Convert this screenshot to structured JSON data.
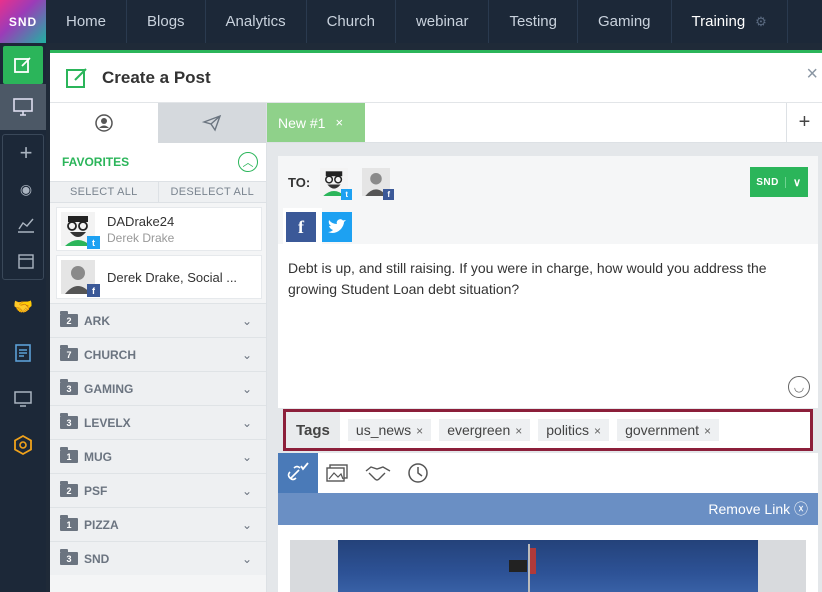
{
  "logo": "SND",
  "nav_tabs": [
    "Home",
    "Blogs",
    "Analytics",
    "Church",
    "webinar",
    "Testing",
    "Gaming",
    "Training"
  ],
  "modal": {
    "title": "Create a Post",
    "close": "×"
  },
  "left": {
    "favorites_label": "FAVORITES",
    "select_all": "SELECT ALL",
    "deselect_all": "DESELECT ALL",
    "accounts": [
      {
        "name": "DADrake24",
        "sub": "Derek Drake",
        "network": "twitter"
      },
      {
        "name": "Derek Drake, Social ...",
        "sub": "",
        "network": "facebook"
      }
    ],
    "groups": [
      {
        "count": "2",
        "name": "ARK"
      },
      {
        "count": "7",
        "name": "CHURCH"
      },
      {
        "count": "3",
        "name": "GAMING"
      },
      {
        "count": "3",
        "name": "LEVELX"
      },
      {
        "count": "1",
        "name": "MUG"
      },
      {
        "count": "2",
        "name": "PSF"
      },
      {
        "count": "1",
        "name": "PIZZA"
      },
      {
        "count": "3",
        "name": "SND"
      }
    ]
  },
  "right": {
    "draft_tab": "New #1",
    "draft_close": "×",
    "add_draft": "+",
    "to_label": "TO:",
    "snd_button": "SND",
    "post_text": "Debt is up, and still raising. If you were in charge, how would you address the growing Student Loan debt situation?",
    "tags_label": "Tags",
    "tags": [
      "us_news",
      "evergreen",
      "politics",
      "government"
    ],
    "remove_link": "Remove Link ⓧ"
  },
  "colors": {
    "accent_green": "#2bb55a",
    "tags_border": "#8c1f3a",
    "link_bar": "#6a8fc4"
  }
}
